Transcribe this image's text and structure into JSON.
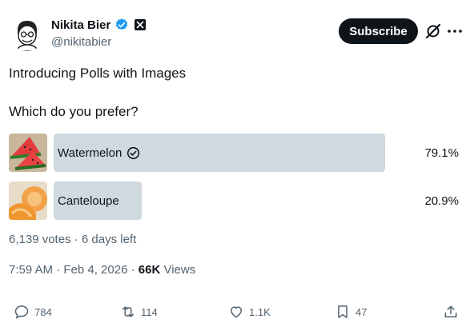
{
  "author": {
    "name": "Nikita Bier",
    "handle": "@nikitabier",
    "avatar_icon": "cartoon-avatar-icon",
    "verified_icon": "verified-badge-icon",
    "affiliate_icon": "x-logo-icon"
  },
  "header": {
    "subscribe_label": "Subscribe",
    "grok_icon": "grok-icon",
    "more_icon": "more-dots-icon"
  },
  "tweet": {
    "text": "Introducing Polls with Images",
    "timestamp_prefix": "7:59 AM · Feb 4, 2026 · ",
    "views_count": "66K",
    "views_label": "Views"
  },
  "poll": {
    "question": "Which do you prefer?",
    "options": [
      {
        "label": "Watermelon",
        "percent": "79.1%",
        "share": 0.791,
        "winner": true,
        "image": "watermelon-image"
      },
      {
        "label": "Canteloupe",
        "percent": "20.9%",
        "share": 0.209,
        "winner": false,
        "image": "cantaloupe-image"
      }
    ],
    "meta": "6,139 votes · 6 days left"
  },
  "actions": {
    "replies": "784",
    "reposts": "114",
    "likes": "1.1K",
    "bookmarks": "47"
  },
  "colors": {
    "text": "#0f1419",
    "secondary": "#536471",
    "poll_bar": "#cfd9de",
    "verified": "#1d9bf0",
    "button": "#0f1419"
  }
}
